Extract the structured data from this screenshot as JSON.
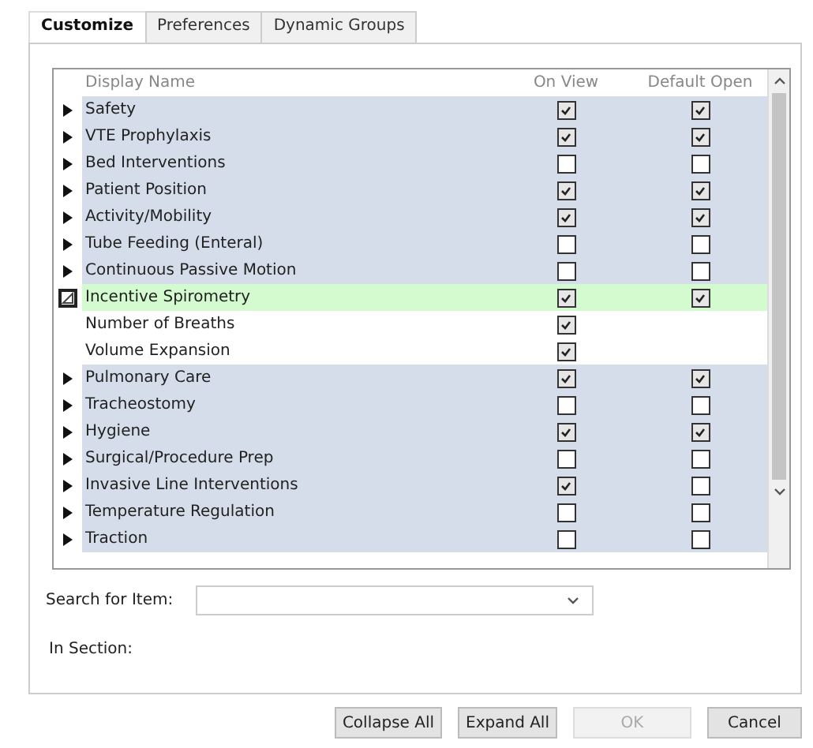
{
  "tabs": [
    {
      "label": "Customize",
      "selected": true
    },
    {
      "label": "Preferences",
      "selected": false
    },
    {
      "label": "Dynamic Groups",
      "selected": false
    }
  ],
  "table": {
    "columns": [
      "Display Name",
      "On View",
      "Default Open"
    ],
    "rows": [
      {
        "name": "Safety",
        "expanded": false,
        "selected": false,
        "on_view": true,
        "default_open": true
      },
      {
        "name": "VTE Prophylaxis",
        "expanded": false,
        "selected": false,
        "on_view": true,
        "default_open": true
      },
      {
        "name": "Bed Interventions",
        "expanded": false,
        "selected": false,
        "on_view": false,
        "default_open": false
      },
      {
        "name": "Patient Position",
        "expanded": false,
        "selected": false,
        "on_view": true,
        "default_open": true
      },
      {
        "name": "Activity/Mobility",
        "expanded": false,
        "selected": false,
        "on_view": true,
        "default_open": true
      },
      {
        "name": "Tube Feeding (Enteral)",
        "expanded": false,
        "selected": false,
        "on_view": false,
        "default_open": false
      },
      {
        "name": "Continuous Passive Motion",
        "expanded": false,
        "selected": false,
        "on_view": false,
        "default_open": false
      },
      {
        "name": "Incentive Spirometry",
        "expanded": true,
        "selected": true,
        "on_view": true,
        "default_open": true,
        "children": [
          {
            "name": "Number of Breaths",
            "on_view": true
          },
          {
            "name": "Volume Expansion",
            "on_view": true
          }
        ]
      },
      {
        "name": "Pulmonary Care",
        "expanded": false,
        "selected": false,
        "on_view": true,
        "default_open": true
      },
      {
        "name": "Tracheostomy",
        "expanded": false,
        "selected": false,
        "on_view": false,
        "default_open": false
      },
      {
        "name": "Hygiene",
        "expanded": false,
        "selected": false,
        "on_view": true,
        "default_open": true
      },
      {
        "name": "Surgical/Procedure Prep",
        "expanded": false,
        "selected": false,
        "on_view": false,
        "default_open": false
      },
      {
        "name": "Invasive Line Interventions",
        "expanded": false,
        "selected": false,
        "on_view": true,
        "default_open": false
      },
      {
        "name": "Temperature Regulation",
        "expanded": false,
        "selected": false,
        "on_view": false,
        "default_open": false
      },
      {
        "name": "Traction",
        "expanded": false,
        "selected": false,
        "on_view": false,
        "default_open": false
      }
    ]
  },
  "search": {
    "label": "Search for Item:"
  },
  "section": {
    "label": "In Section:"
  },
  "buttons": [
    {
      "label": "Collapse All",
      "disabled": false
    },
    {
      "label": "Expand All",
      "disabled": false
    },
    {
      "label": "OK",
      "disabled": true
    },
    {
      "label": "Cancel",
      "disabled": false
    }
  ]
}
